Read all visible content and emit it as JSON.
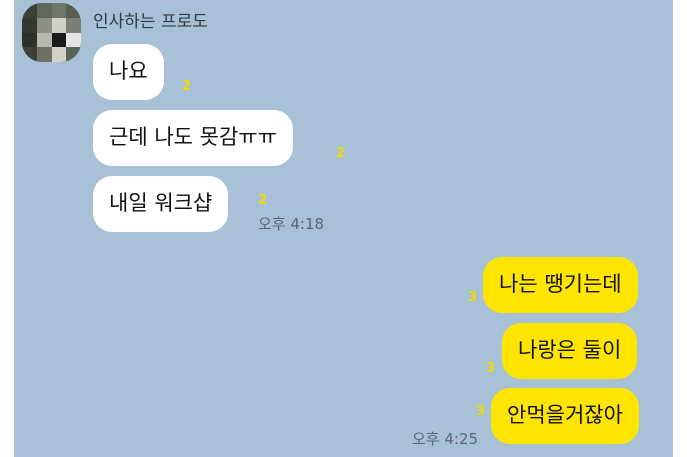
{
  "left": {
    "sender_name": "인사하는 프로도",
    "messages": [
      {
        "text": "나요",
        "unread": "2"
      },
      {
        "text": "근데 나도 못감ㅠㅠ",
        "unread": "2"
      },
      {
        "text": "내일 워크샵",
        "unread": "2"
      }
    ],
    "time": "오후 4:18"
  },
  "right": {
    "messages": [
      {
        "text": "나는 땡기는데",
        "unread": "3"
      },
      {
        "text": "나랑은 둘이",
        "unread": "3"
      },
      {
        "text": "안먹을거잖아",
        "unread": "3"
      }
    ],
    "time": "오후 4:25"
  },
  "colors": {
    "background": "#a9c1d7",
    "incoming_bubble": "#ffffff",
    "outgoing_bubble": "#fee500",
    "unread_count": "#f2d900"
  }
}
